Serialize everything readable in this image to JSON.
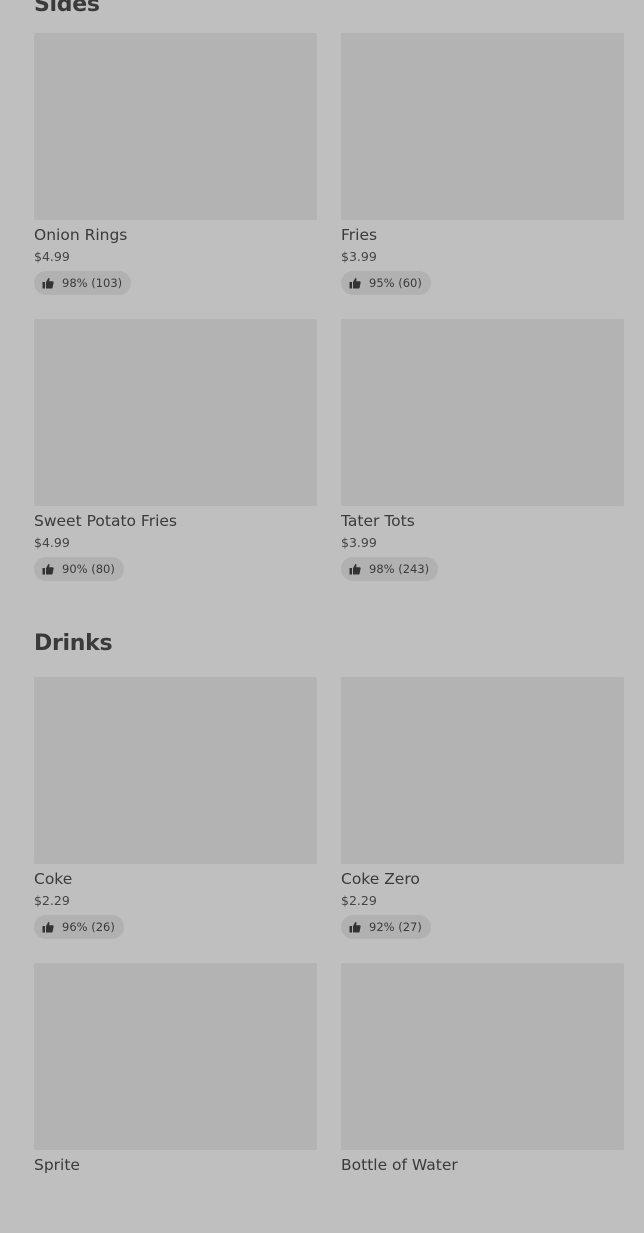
{
  "sections": [
    {
      "title": "Sides",
      "items": [
        {
          "name": "Onion Rings",
          "price": "$4.99",
          "rating": "98% (103)"
        },
        {
          "name": "Fries",
          "price": "$3.99",
          "rating": "95% (60)"
        },
        {
          "name": "Sweet Potato Fries",
          "price": "$4.99",
          "rating": "90% (80)"
        },
        {
          "name": "Tater Tots",
          "price": "$3.99",
          "rating": "98% (243)"
        }
      ]
    },
    {
      "title": "Drinks",
      "items": [
        {
          "name": "Coke",
          "price": "$2.29",
          "rating": "96% (26)"
        },
        {
          "name": "Coke Zero",
          "price": "$2.29",
          "rating": "92% (27)"
        },
        {
          "name": "Sprite",
          "price": "",
          "rating": ""
        },
        {
          "name": "Bottle of Water",
          "price": "",
          "rating": ""
        }
      ]
    }
  ],
  "icons": {
    "rating": "thumbs-up-icon"
  },
  "colors": {
    "background": "#bfbfbf",
    "thumbnail": "#b3b3b3",
    "text": "#333333"
  }
}
